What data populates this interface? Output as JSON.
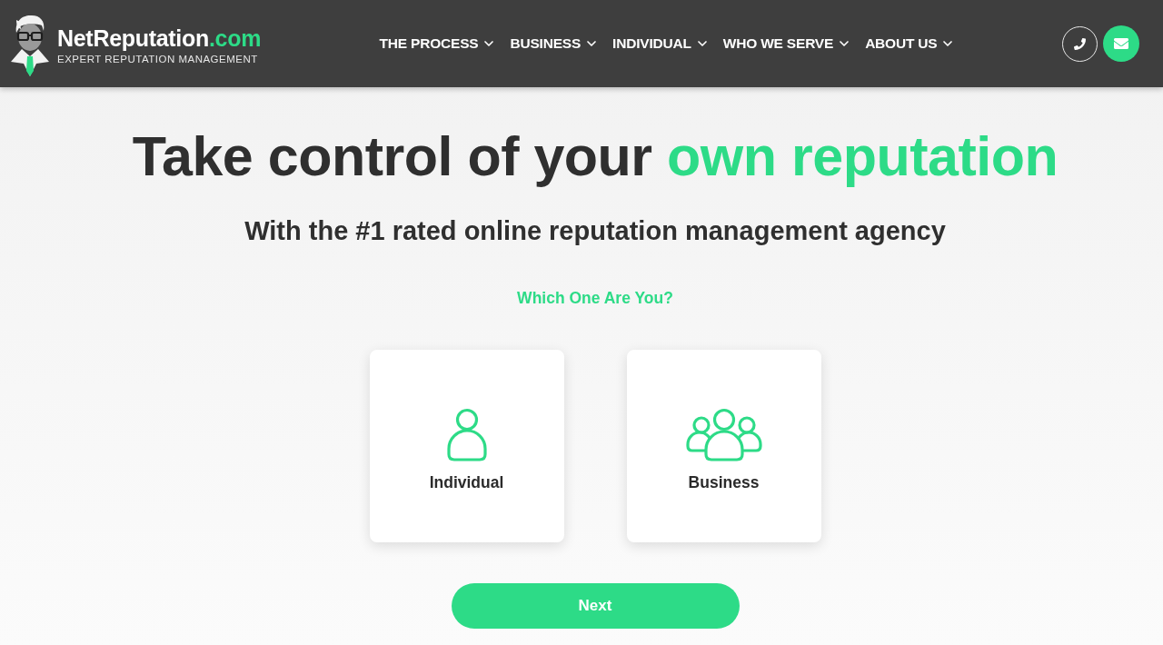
{
  "header": {
    "logo": {
      "name": "NetReputation",
      "suffix": ".com",
      "tagline": "EXPERT REPUTATION MANAGEMENT"
    },
    "nav": [
      {
        "label": "THE PROCESS"
      },
      {
        "label": "BUSINESS"
      },
      {
        "label": "INDIVIDUAL"
      },
      {
        "label": "WHO WE SERVE"
      },
      {
        "label": "ABOUT US"
      }
    ]
  },
  "hero": {
    "title": "Take control of your",
    "title_highlight": "own reputation",
    "subtitle": "With the #1 rated online reputation management agency"
  },
  "chooser": {
    "prompt": "Which One Are You?",
    "options": [
      {
        "kind": "person",
        "label": "Individual",
        "selected": false
      },
      {
        "kind": "group",
        "label": "Business",
        "selected": false
      }
    ],
    "next_button": "Next"
  }
}
